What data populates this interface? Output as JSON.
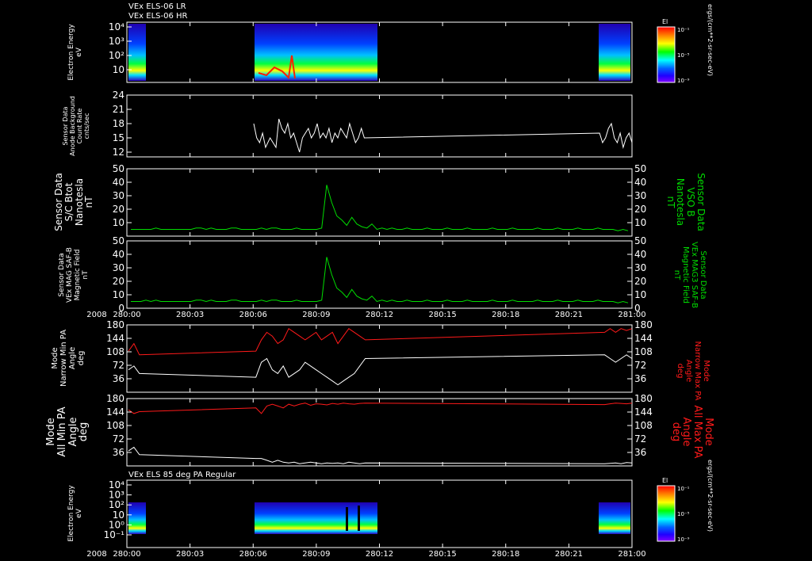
{
  "header": {
    "line1": "VEx ELS-06 LR",
    "line2": "VEx ELS-06 HR"
  },
  "footer_titles": {
    "bottom_panel": "VEx ELS 85 deg PA Regular"
  },
  "x_axis": {
    "tick_labels": [
      "280:00",
      "280:03",
      "280:06",
      "280:09",
      "280:12",
      "280:15",
      "280:18",
      "280:21",
      "281:00"
    ],
    "year_label": "2008"
  },
  "colorbar": {
    "title": "El",
    "top_label": "10⁻¹",
    "mid_label": "10⁻⁵",
    "bot_label": "10⁻⁹",
    "units": "ergs/(cm**2-sr-sec-eV)",
    "colors": [
      "#ff0000",
      "#ff7f00",
      "#ffff00",
      "#7fff00",
      "#00ff00",
      "#00ffff",
      "#0080ff",
      "#0000ff",
      "#8000ff"
    ]
  },
  "colors": {
    "white": "#ffffff",
    "green": "#00dd00",
    "red": "#ff1a1a",
    "frame": "#ffffff"
  },
  "chart_data": [
    {
      "id": "electron-energy-spectrogram",
      "type": "heatmap",
      "ylabel_lines": [
        "Electron Energy",
        "eV"
      ],
      "y_tick_labels": [
        "10⁴",
        "10³",
        "10²",
        "10"
      ],
      "data_intervals": [
        [
          "280:00",
          "280:01"
        ],
        [
          "280:06",
          "280:11.5"
        ],
        [
          "280:22",
          "281:00"
        ]
      ]
    },
    {
      "id": "sensor-background",
      "type": "line",
      "ylabel_lines": [
        "Sensor Data",
        "Anode Background",
        "Count Rate",
        "cnts/sec"
      ],
      "ylim": [
        11,
        24
      ],
      "y_tick_labels": [
        "24",
        "21",
        "18",
        "15",
        "12"
      ],
      "series": [
        {
          "values": [
            18,
            15,
            14,
            16,
            13,
            15,
            14,
            13,
            19,
            17,
            16,
            18,
            15,
            16,
            14,
            12,
            15,
            16,
            17,
            15,
            16,
            18,
            15,
            16,
            15,
            17,
            14,
            16,
            15,
            17,
            16,
            15,
            18,
            16,
            14,
            15,
            17,
            15,
            16,
            14,
            15,
            17,
            18,
            15,
            14,
            16,
            13,
            15,
            16,
            14
          ]
        }
      ]
    },
    {
      "id": "sc-bmag",
      "type": "line",
      "ylabel_lines": [
        "Sensor Data",
        "S/C Btot",
        "Nanotesla",
        "nT"
      ],
      "right_label_lines": [
        "Sensor Data",
        "VSO B",
        "Nanotesla",
        "nT"
      ],
      "ylim": [
        0,
        50
      ],
      "y_tick_labels": [
        "50",
        "40",
        "30",
        "20",
        "10"
      ],
      "series": [
        {
          "values": [
            5,
            5,
            5,
            5,
            5,
            6,
            5,
            5,
            5,
            5,
            5,
            5,
            5,
            6,
            6,
            5,
            6,
            5,
            5,
            5,
            6,
            6,
            5,
            5,
            5,
            5,
            6,
            5,
            6,
            6,
            5,
            5,
            5,
            6,
            5,
            5,
            5,
            5,
            6,
            38,
            25,
            15,
            12,
            8,
            14,
            9,
            7,
            6,
            9,
            5,
            6,
            5,
            6,
            5,
            5,
            6,
            5,
            5,
            5,
            6,
            5,
            5,
            5,
            6,
            5,
            5,
            5,
            6,
            5,
            5,
            5,
            5,
            6,
            5,
            5,
            5,
            6,
            5,
            5,
            5,
            5,
            6,
            5,
            5,
            5,
            6,
            5,
            5,
            5,
            6,
            5,
            5,
            5,
            6,
            5,
            5,
            5,
            4,
            5,
            4
          ]
        }
      ]
    },
    {
      "id": "mag-field",
      "type": "line",
      "ylabel_lines": [
        "Sensor Data",
        "VEx MAG SAF-B",
        "Magnetic Field",
        "nT"
      ],
      "right_label_lines": [
        "Sensor Data",
        "VEx MAG3 SAF-B",
        "Magnetic Field",
        "nT"
      ],
      "ylim": [
        0,
        50
      ],
      "y_tick_labels": [
        "50",
        "40",
        "30",
        "20",
        "10",
        "0"
      ],
      "series": [
        {
          "values": [
            5,
            5,
            5,
            6,
            5,
            6,
            5,
            5,
            5,
            5,
            5,
            5,
            5,
            6,
            6,
            5,
            6,
            5,
            5,
            5,
            6,
            6,
            5,
            5,
            5,
            5,
            6,
            5,
            6,
            6,
            5,
            5,
            5,
            6,
            5,
            5,
            5,
            5,
            6,
            38,
            25,
            15,
            12,
            8,
            14,
            9,
            7,
            6,
            9,
            5,
            6,
            5,
            6,
            5,
            5,
            6,
            5,
            5,
            5,
            6,
            5,
            5,
            5,
            6,
            5,
            5,
            5,
            6,
            5,
            5,
            5,
            5,
            6,
            5,
            5,
            5,
            6,
            5,
            5,
            5,
            5,
            6,
            5,
            5,
            5,
            6,
            5,
            5,
            5,
            6,
            5,
            5,
            5,
            6,
            5,
            5,
            5,
            4,
            5,
            4
          ]
        }
      ]
    },
    {
      "id": "narrow-pa",
      "type": "line",
      "ylabel_lines": [
        "Mode",
        "Narrow Min PA",
        "Angle",
        "deg"
      ],
      "right_label_lines": [
        "Mode",
        "Narrow Max PA",
        "Angle",
        "deg"
      ],
      "ylim": [
        0,
        180
      ],
      "y_tick_labels": [
        "180",
        "144",
        "108",
        "72",
        "36"
      ],
      "series": [
        {
          "name": "Min PA",
          "color": "white",
          "values": [
            60,
            70,
            50,
            40,
            80,
            90,
            60,
            50,
            70,
            40,
            50,
            60,
            80,
            70,
            60,
            50,
            40,
            30,
            20,
            30,
            40,
            50,
            70,
            90,
            100,
            90,
            80,
            90,
            100,
            90
          ]
        },
        {
          "name": "Max PA",
          "color": "red",
          "values": [
            110,
            130,
            100,
            110,
            140,
            160,
            150,
            130,
            140,
            170,
            160,
            150,
            140,
            150,
            160,
            140,
            150,
            160,
            130,
            150,
            170,
            160,
            150,
            140,
            160,
            170,
            160,
            170,
            165,
            170
          ]
        }
      ]
    },
    {
      "id": "all-pa",
      "type": "line",
      "ylabel_lines": [
        "Mode",
        "All Min PA",
        "Angle",
        "deg"
      ],
      "right_label_lines": [
        "Mode",
        "All Max PA",
        "Angle",
        "deg"
      ],
      "ylim": [
        0,
        180
      ],
      "y_tick_labels": [
        "180",
        "144",
        "108",
        "72",
        "36"
      ],
      "series": [
        {
          "name": "Min PA",
          "color": "white",
          "values": [
            40,
            50,
            30,
            20,
            20,
            15,
            10,
            15,
            10,
            8,
            10,
            6,
            8,
            10,
            8,
            6,
            8,
            7,
            8,
            6,
            10,
            8,
            6,
            8,
            6,
            7,
            8,
            6,
            9,
            8
          ]
        },
        {
          "name": "Max PA",
          "color": "red",
          "values": [
            150,
            140,
            145,
            155,
            140,
            160,
            165,
            160,
            155,
            165,
            160,
            165,
            168,
            162,
            166,
            165,
            163,
            167,
            165,
            168,
            166,
            165,
            167,
            168,
            164,
            166,
            168,
            167,
            166,
            168
          ]
        }
      ]
    },
    {
      "id": "electron-energy-85deg",
      "type": "heatmap",
      "ylabel_lines": [
        "Electron Energy",
        "eV"
      ],
      "y_tick_labels": [
        "10⁴",
        "10³",
        "10²",
        "10",
        "10⁰",
        "10⁻¹"
      ],
      "data_intervals": [
        [
          "280:00",
          "280:01"
        ],
        [
          "280:06",
          "280:11.5"
        ],
        [
          "280:22",
          "281:00"
        ]
      ]
    }
  ]
}
